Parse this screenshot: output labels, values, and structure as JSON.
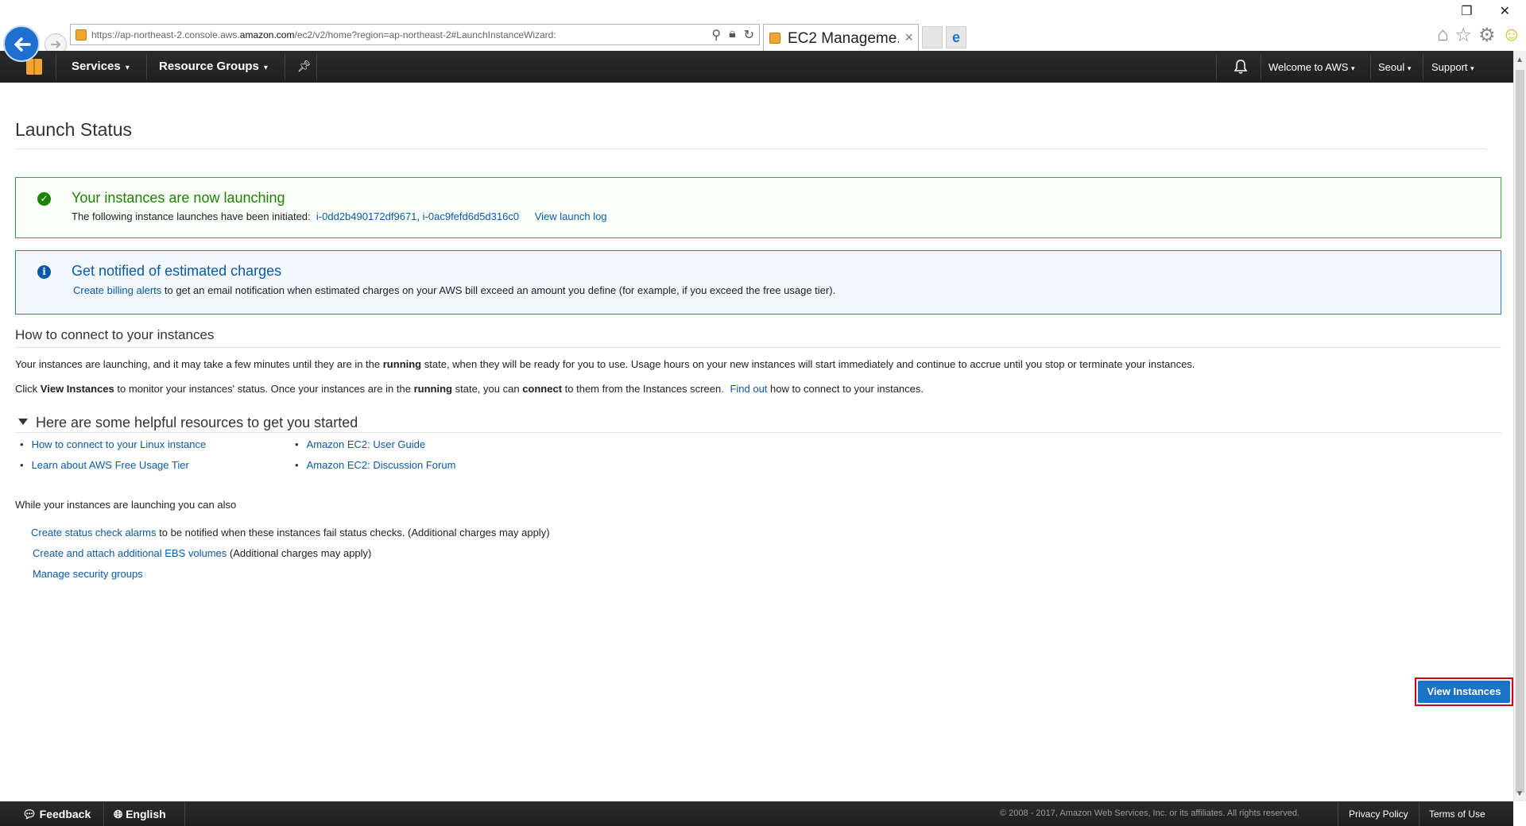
{
  "browser": {
    "url_prefix": "https://ap-northeast-2.console.aws.",
    "url_domain": "amazon.com",
    "url_suffix": "/ec2/v2/home?region=ap-northeast-2#LaunchInstanceWizard:",
    "tab_title": "EC2 Manageme...",
    "tab_close": "×"
  },
  "nav": {
    "services": "Services",
    "resource_groups": "Resource Groups",
    "welcome": "Welcome to AWS",
    "region": "Seoul",
    "support": "Support",
    "caret": "▾"
  },
  "page": {
    "title": "Launch Status"
  },
  "success_alert": {
    "title": "Your instances are now launching",
    "body_prefix": "The following instance launches have been initiated:",
    "instance_1": "i-0dd2b490172df9671",
    "separator": ",",
    "instance_2": "i-0ac9fefd6d5d316c0",
    "view_log": "View launch log"
  },
  "info_alert": {
    "title": "Get notified of estimated charges",
    "link": "Create billing alerts",
    "body": "to get an email notification when estimated charges on your AWS bill exceed an amount you define (for example, if you exceed the free usage tier)."
  },
  "connect": {
    "heading": "How to connect to your instances",
    "p1_a": "Your instances are launching, and it may take a few minutes until they are in the",
    "p1_bold": "running",
    "p1_b": "state, when they will be ready for you to use. Usage hours on your new instances will start immediately and continue to accrue until you stop or terminate your instances.",
    "p2_a": "Click",
    "p2_bold1": "View Instances",
    "p2_b": "to monitor your instances' status. Once your instances are in the",
    "p2_bold2": "running",
    "p2_c": "state, you can",
    "p2_bold3": "connect",
    "p2_d": "to them from the Instances screen.",
    "p2_link": "Find out",
    "p2_e": "how to connect to your instances."
  },
  "resources": {
    "heading": "Here are some helpful resources to get you started",
    "left": [
      "How to connect to your Linux instance",
      "Learn about AWS Free Usage Tier"
    ],
    "right": [
      "Amazon EC2: User Guide",
      "Amazon EC2: Discussion Forum"
    ],
    "bullet": "•"
  },
  "also": {
    "heading": "While your instances are launching you can also",
    "item1_link": "Create status check alarms",
    "item1_text": "to be notified when these instances fail status checks. (Additional charges may apply)",
    "item2_link": "Create and attach additional EBS volumes",
    "item2_text": "(Additional charges may apply)",
    "item3_link": "Manage security groups"
  },
  "actions": {
    "view_instances": "View Instances"
  },
  "footer": {
    "feedback": "Feedback",
    "language": "English",
    "copyright": "© 2008 - 2017, Amazon Web Services, Inc. or its affiliates. All rights reserved.",
    "privacy": "Privacy Policy",
    "terms": "Terms of Use"
  },
  "colors": {
    "nav_bg": "#232323",
    "success": "#1d8102",
    "info": "#0a5aa8",
    "link": "#0a5aa8",
    "button": "#1a73c9",
    "highlight_border": "#d0021b"
  },
  "icons": [
    "back-arrow-icon",
    "forward-arrow-icon",
    "search-icon",
    "lock-icon",
    "refresh-icon",
    "home-icon",
    "favorites-star-icon",
    "settings-gear-icon",
    "smiley-icon",
    "aws-cube-icon",
    "pin-icon",
    "bell-icon",
    "check-circle-icon",
    "info-circle-icon",
    "feedback-bubble-icon",
    "globe-icon"
  ]
}
